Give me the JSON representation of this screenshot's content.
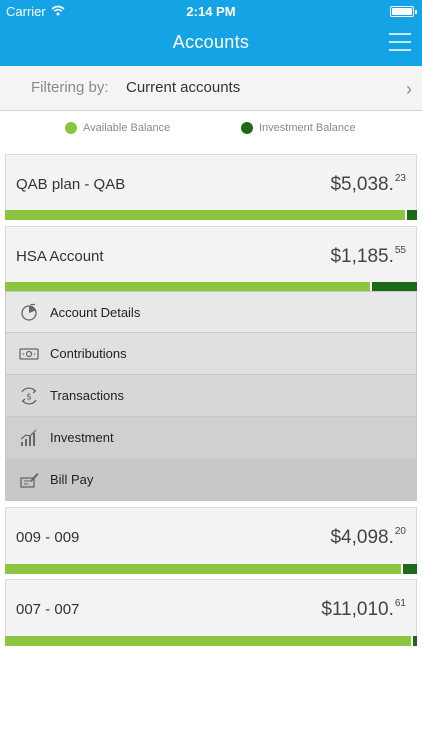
{
  "status_bar": {
    "carrier": "Carrier",
    "time": "2:14 PM"
  },
  "header": {
    "title": "Accounts"
  },
  "filter": {
    "label": "Filtering by:",
    "value": "Current accounts"
  },
  "legend": {
    "available": {
      "label": "Available Balance",
      "color": "#8cc63f"
    },
    "investment": {
      "label": "Investment Balance",
      "color": "#1b6b1b"
    }
  },
  "accounts": [
    {
      "name": "QAB plan - QAB",
      "amount_main": "$5,038.",
      "amount_cents": "23",
      "available_fraction": 0.97
    },
    {
      "name": "HSA Account",
      "amount_main": "$1,185.",
      "amount_cents": "55",
      "available_fraction": 0.885
    },
    {
      "name": "009 - 009",
      "amount_main": "$4,098.",
      "amount_cents": "20",
      "available_fraction": 0.96
    },
    {
      "name": "007 - 007",
      "amount_main": "$11,010.",
      "amount_cents": "61",
      "available_fraction": 0.985
    }
  ],
  "submenu": [
    {
      "label": "Account Details",
      "icon": "account-details-icon",
      "bg": "#e8e8e8"
    },
    {
      "label": "Contributions",
      "icon": "contributions-icon",
      "bg": "#e0e0e0"
    },
    {
      "label": "Transactions",
      "icon": "transactions-icon",
      "bg": "#d8d8d8"
    },
    {
      "label": "Investment",
      "icon": "investment-icon",
      "bg": "#d0d0d0"
    },
    {
      "label": "Bill Pay",
      "icon": "bill-pay-icon",
      "bg": "#c8c8c8"
    }
  ]
}
